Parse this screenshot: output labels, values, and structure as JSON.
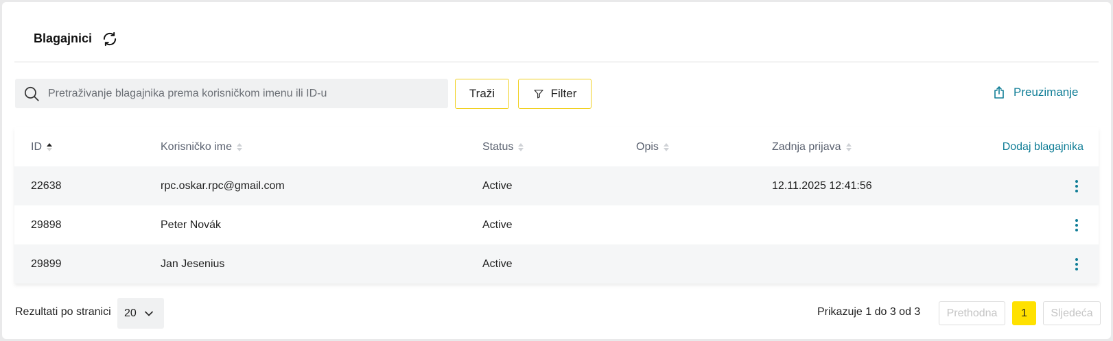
{
  "header": {
    "title": "Blagajnici"
  },
  "toolbar": {
    "search_placeholder": "Pretraživanje blagajnika prema korisničkom imenu ili ID-u",
    "search_value": "",
    "search_button": "Traži",
    "filter_button": "Filter",
    "download_link": "Preuzimanje"
  },
  "table": {
    "columns": {
      "id": "ID",
      "username": "Korisničko ime",
      "status": "Status",
      "description": "Opis",
      "last_login": "Zadnja prijava",
      "add": "Dodaj blagajnika"
    },
    "rows": [
      {
        "id": "22638",
        "username": "rpc.oskar.rpc@gmail.com",
        "status": "Active",
        "description": "",
        "last_login": "12.11.2025 12:41:56"
      },
      {
        "id": "29898",
        "username": "Peter Novák",
        "status": "Active",
        "description": "",
        "last_login": ""
      },
      {
        "id": "29899",
        "username": "Jan Jesenius",
        "status": "Active",
        "description": "",
        "last_login": ""
      }
    ]
  },
  "footer": {
    "per_page_label": "Rezultati po stranici",
    "per_page_value": "20",
    "showing": "Prikazuje 1 do 3 od 3",
    "prev": "Prethodna",
    "current_page": "1",
    "next": "Sljedeća"
  },
  "colors": {
    "accent_yellow": "#ffe100",
    "button_border": "#f0cf1a",
    "link_teal": "#0f7d96"
  }
}
